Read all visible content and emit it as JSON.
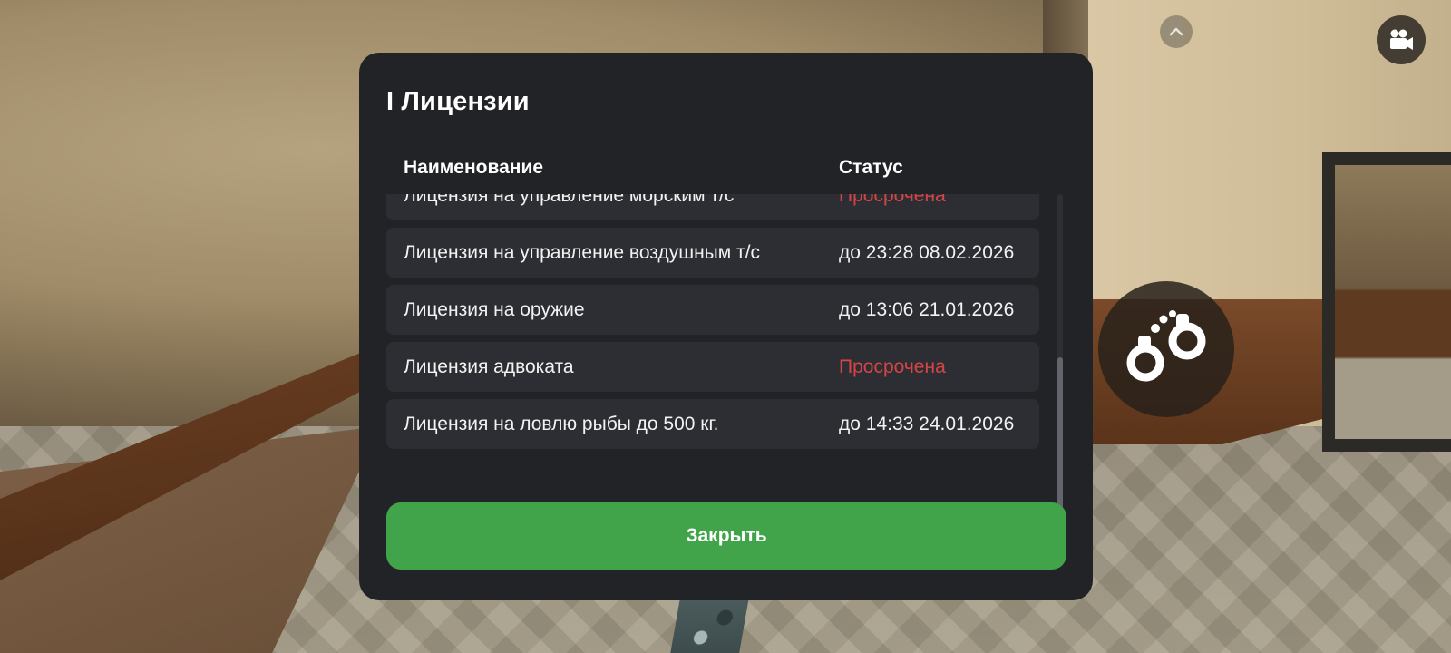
{
  "hud": {
    "collapse_icon": "chevron-up-icon",
    "camera_icon": "video-camera-icon",
    "action_icon": "handcuffs-icon"
  },
  "modal": {
    "title": "I Лицензии",
    "columns": {
      "name": "Наименование",
      "status": "Статус"
    },
    "licenses": [
      {
        "name": "Лицензия на управление морским т/с",
        "status": "Просрочена",
        "expired": true
      },
      {
        "name": "Лицензия на управление воздушным т/с",
        "status": "до 23:28 08.02.2026",
        "expired": false
      },
      {
        "name": "Лицензия на оружие",
        "status": "до 13:06 21.01.2026",
        "expired": false
      },
      {
        "name": "Лицензия адвоката",
        "status": "Просрочена",
        "expired": true
      },
      {
        "name": "Лицензия на ловлю рыбы до 500 кг.",
        "status": "до 14:33 24.01.2026",
        "expired": false
      }
    ],
    "close_label": "Закрыть"
  },
  "colors": {
    "panel_bg": "#222327",
    "row_bg": "#2d2e33",
    "expired": "#d64545",
    "button": "#41a34a"
  }
}
